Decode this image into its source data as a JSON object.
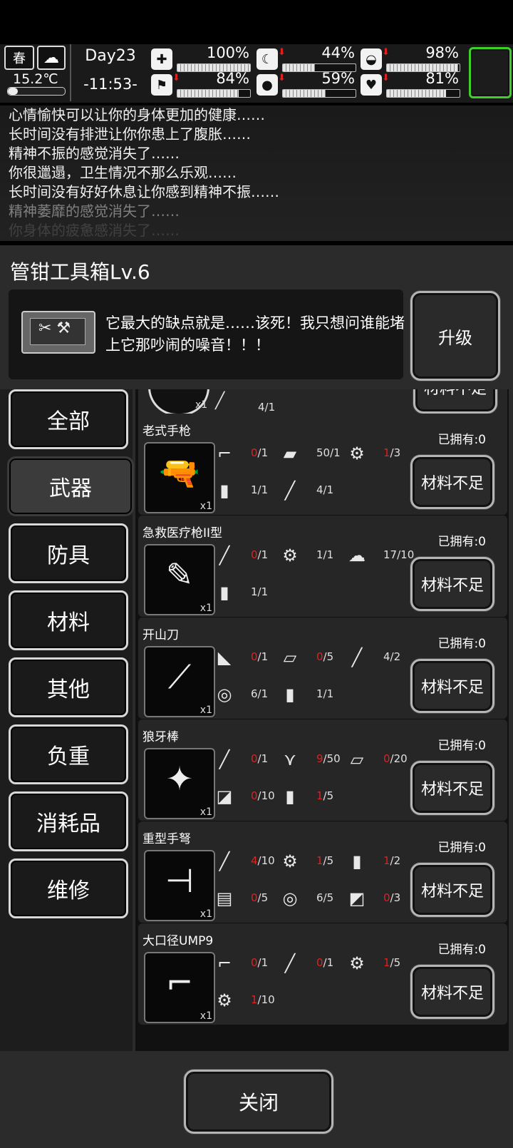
{
  "hud": {
    "season": "春",
    "temperature": "15.2℃",
    "day": "Day23",
    "time": "-11:53-",
    "stats": [
      {
        "icon": "health-icon",
        "glyph": "✚",
        "value": "100%",
        "fill": 1.0,
        "down": false
      },
      {
        "icon": "stomach-icon",
        "glyph": "☾",
        "value": "44%",
        "fill": 0.44,
        "down": true
      },
      {
        "icon": "bladder-icon",
        "glyph": "◒",
        "value": "98%",
        "fill": 0.98,
        "down": true
      },
      {
        "icon": "boot-icon",
        "glyph": "⚑",
        "value": "84%",
        "fill": 0.84,
        "down": true
      },
      {
        "icon": "water-drop-icon",
        "glyph": "●",
        "value": "59%",
        "fill": 0.59,
        "down": true
      },
      {
        "icon": "heart-icon",
        "glyph": "♥",
        "value": "81%",
        "fill": 0.81,
        "down": true
      }
    ]
  },
  "log": [
    "心情愉快可以让你的身体更加的健康……",
    "长时间没有排泄让你你患上了腹胀……",
    "精神不振的感觉消失了……",
    "你很邋遢，卫生情况不那么乐观……",
    "长时间没有好好休息让你感到精神不振……",
    "精神萎靡的感觉消失了……",
    "你身体的疲惫感消失了……"
  ],
  "workbench": {
    "title": "管钳工具箱Lv.6",
    "description": "它最大的缺点就是……该死！我只想问谁能堵上它那吵闹的噪音！！！",
    "upgrade_label": "升级"
  },
  "categories": [
    "全部",
    "武器",
    "防具",
    "材料",
    "其他",
    "负重",
    "消耗品",
    "维修"
  ],
  "active_category": "武器",
  "partial_top": {
    "count": "4/1",
    "button": "材料不足"
  },
  "recipes": [
    {
      "name": "老式手枪",
      "owned": "已拥有:0",
      "button": "材料不足",
      "icon": "revolver-icon",
      "glyph": "🔫",
      "materials": [
        {
          "icon": "gun-parts-icon",
          "glyph": "⌐",
          "have": "0",
          "need": "/1",
          "red": true
        },
        {
          "icon": "metal-bar-icon",
          "glyph": "▰",
          "have": "50",
          "need": "/1",
          "red": false
        },
        {
          "icon": "gear-icon",
          "glyph": "⚙",
          "have": "1",
          "need": "/3",
          "red": true
        },
        {
          "icon": "jerrycan-icon",
          "glyph": "▮",
          "have": "1",
          "need": "/1",
          "red": false
        },
        {
          "icon": "pipe-icon",
          "glyph": "╱",
          "have": "4",
          "need": "/1",
          "red": false
        }
      ]
    },
    {
      "name": "急救医疗枪II型",
      "owned": "已拥有:0",
      "button": "材料不足",
      "icon": "medical-gun-icon",
      "glyph": "✎",
      "materials": [
        {
          "icon": "syringe-icon",
          "glyph": "╱",
          "have": "0",
          "need": "/1",
          "red": true
        },
        {
          "icon": "gold-gear-icon",
          "glyph": "⚙",
          "have": "1",
          "need": "/1",
          "red": false,
          "yellow": true
        },
        {
          "icon": "cotton-icon",
          "glyph": "☁",
          "have": "17",
          "need": "/10",
          "red": false
        },
        {
          "icon": "jerrycan-icon",
          "glyph": "▮",
          "have": "1",
          "need": "/1",
          "red": false
        }
      ]
    },
    {
      "name": "开山刀",
      "owned": "已拥有:0",
      "button": "材料不足",
      "icon": "machete-icon",
      "glyph": "⟋",
      "materials": [
        {
          "icon": "blade-part-icon",
          "glyph": "◣",
          "have": "0",
          "need": "/1",
          "red": true
        },
        {
          "icon": "metal-sheet-icon",
          "glyph": "▱",
          "have": "0",
          "need": "/5",
          "red": true
        },
        {
          "icon": "pipe-icon",
          "glyph": "╱",
          "have": "4",
          "need": "/2",
          "red": false
        },
        {
          "icon": "cloth-roll-icon",
          "glyph": "◎",
          "have": "6",
          "need": "/1",
          "red": false
        },
        {
          "icon": "jerrycan-icon",
          "glyph": "▮",
          "have": "1",
          "need": "/1",
          "red": false
        }
      ]
    },
    {
      "name": "狼牙棒",
      "owned": "已拥有:0",
      "button": "材料不足",
      "icon": "spiked-club-icon",
      "glyph": "✦",
      "materials": [
        {
          "icon": "stick-icon",
          "glyph": "╱",
          "have": "0",
          "need": "/1",
          "red": true
        },
        {
          "icon": "nails-icon",
          "glyph": "⋎",
          "have": "9",
          "need": "/50",
          "red": true
        },
        {
          "icon": "metal-sheet-icon",
          "glyph": "▱",
          "have": "0",
          "need": "/20",
          "red": true
        },
        {
          "icon": "scrap-metal-icon",
          "glyph": "◪",
          "have": "0",
          "need": "/10",
          "red": true
        },
        {
          "icon": "jerrycan-icon",
          "glyph": "▮",
          "have": "1",
          "need": "/5",
          "red": true
        }
      ]
    },
    {
      "name": "重型手弩",
      "owned": "已拥有:0",
      "button": "材料不足",
      "icon": "crossbow-icon",
      "glyph": "⊣",
      "materials": [
        {
          "icon": "pipe-icon",
          "glyph": "╱",
          "have": "4",
          "need": "/10",
          "red": true
        },
        {
          "icon": "gear-icon",
          "glyph": "⚙",
          "have": "1",
          "need": "/5",
          "red": true
        },
        {
          "icon": "jerrycan-icon",
          "glyph": "▮",
          "have": "1",
          "need": "/2",
          "red": true
        },
        {
          "icon": "yellow-vest-icon",
          "glyph": "▤",
          "have": "0",
          "need": "/5",
          "red": true,
          "yellow": true
        },
        {
          "icon": "cloth-roll-icon",
          "glyph": "◎",
          "have": "6",
          "need": "/5",
          "red": false
        },
        {
          "icon": "leather-icon",
          "glyph": "◩",
          "have": "0",
          "need": "/3",
          "red": true
        }
      ]
    },
    {
      "name": "大口径UMP9",
      "owned": "已拥有:0",
      "button": "材料不足",
      "icon": "smg-icon",
      "glyph": "⌐",
      "materials": [
        {
          "icon": "rifle-parts-icon",
          "glyph": "⌐",
          "have": "0",
          "need": "/1",
          "red": true
        },
        {
          "icon": "barrel-icon",
          "glyph": "╱",
          "have": "0",
          "need": "/1",
          "red": true
        },
        {
          "icon": "gold-gear-icon",
          "glyph": "⚙",
          "have": "1",
          "need": "/5",
          "red": true,
          "yellow": true
        },
        {
          "icon": "gear-icon",
          "glyph": "⚙",
          "have": "1",
          "need": "/10",
          "red": true
        }
      ]
    }
  ],
  "close_label": "关闭"
}
